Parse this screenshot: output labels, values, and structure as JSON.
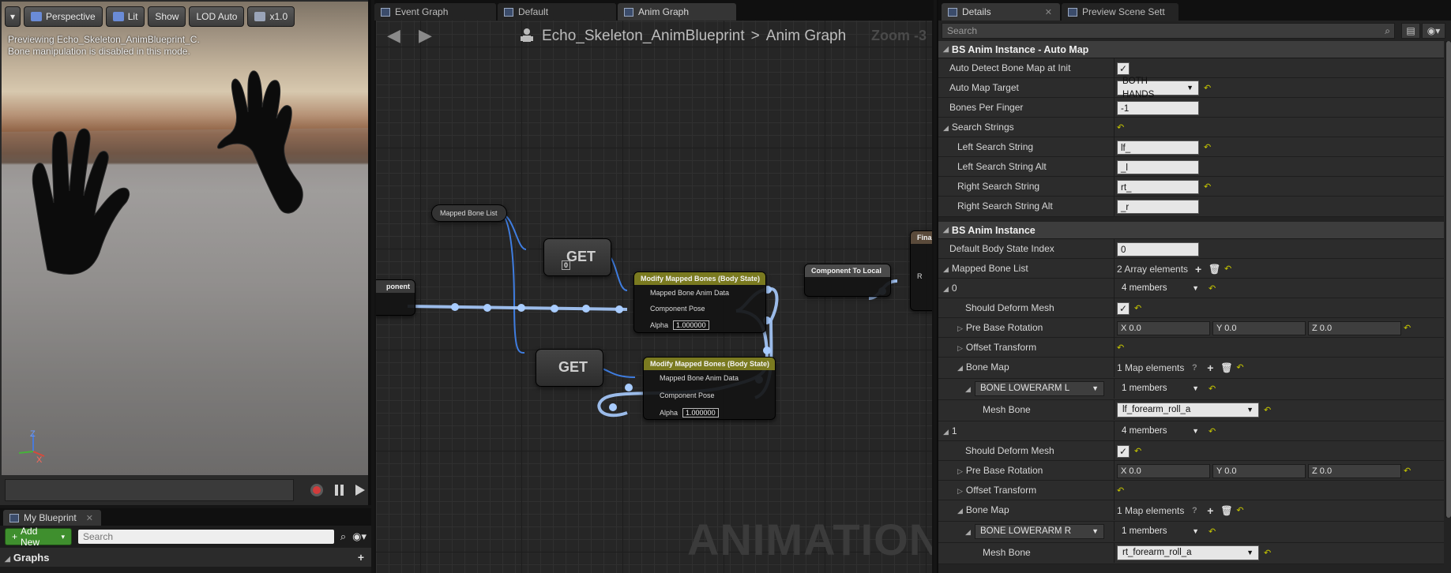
{
  "viewport": {
    "toolbar": {
      "menu_arrow": "▾",
      "perspective": "Perspective",
      "lit": "Lit",
      "show": "Show",
      "lod": "LOD Auto",
      "speed": "x1.0"
    },
    "message_line1": "Previewing Echo_Skeleton_AnimBlueprint_C.",
    "message_line2": "Bone manipulation is disabled in this mode.",
    "axis_x": "X",
    "axis_z": "Z"
  },
  "my_blueprint": {
    "tab": "My Blueprint",
    "add_new": "Add New",
    "search_placeholder": "Search",
    "graphs": "Graphs"
  },
  "graph_editor": {
    "tabs": [
      "Event Graph",
      "Default",
      "Anim Graph"
    ],
    "breadcrumb_root": "Echo_Skeleton_AnimBlueprint",
    "breadcrumb_sep": ">",
    "breadcrumb_leaf": "Anim Graph",
    "zoom": "Zoom -3",
    "watermark": "ANIMATION",
    "nodes": {
      "mapped_bone_list": "Mapped Bone List",
      "get": "GET",
      "get_index": "0",
      "component_left": "ponent",
      "modify_title": "Modify Mapped Bones (Body State)",
      "pin_mapped": "Mapped Bone Anim Data",
      "pin_pose": "Component Pose",
      "pin_alpha": "Alpha",
      "alpha_value": "1.000000",
      "component_to_local": "Component To Local",
      "final": "Final",
      "final_pin": "R"
    }
  },
  "details": {
    "tabs": [
      "Details",
      "Preview Scene Sett"
    ],
    "search_placeholder": "Search",
    "auto_map": {
      "title": "BS Anim Instance - Auto Map",
      "auto_detect_label": "Auto Detect Bone Map at Init",
      "auto_map_target_label": "Auto Map Target",
      "auto_map_target_value": "BOTH HANDS",
      "bones_per_finger_label": "Bones Per Finger",
      "bones_per_finger_value": "-1",
      "search_strings_label": "Search Strings",
      "left_search_label": "Left Search String",
      "left_search_value": "lf_",
      "left_search_alt_label": "Left Search String Alt",
      "left_search_alt_value": "_l",
      "right_search_label": "Right Search String",
      "right_search_value": "rt_",
      "right_search_alt_label": "Right Search String Alt",
      "right_search_alt_value": "_r"
    },
    "instance": {
      "title": "BS Anim Instance",
      "default_body_state_label": "Default Body State Index",
      "default_body_state_value": "0",
      "mapped_bone_list_label": "Mapped Bone List",
      "mapped_bone_list_value": "2 Array elements",
      "entries": [
        {
          "index": "0",
          "members": "4 members",
          "deform_label": "Should Deform Mesh",
          "pre_base_label": "Pre Base Rotation",
          "x": "X  0.0",
          "y": "Y  0.0",
          "z": "Z  0.0",
          "offset_label": "Offset Transform",
          "bone_map_label": "Bone Map",
          "bone_map_value": "1 Map elements",
          "key": "BONE LOWERARM L",
          "key_members": "1 members",
          "mesh_bone_label": "Mesh Bone",
          "mesh_bone_value": "lf_forearm_roll_a"
        },
        {
          "index": "1",
          "members": "4 members",
          "deform_label": "Should Deform Mesh",
          "pre_base_label": "Pre Base Rotation",
          "x": "X  0.0",
          "y": "Y  0.0",
          "z": "Z  0.0",
          "offset_label": "Offset Transform",
          "bone_map_label": "Bone Map",
          "bone_map_value": "1 Map elements",
          "key": "BONE LOWERARM R",
          "key_members": "1 members",
          "mesh_bone_label": "Mesh Bone",
          "mesh_bone_value": "rt_forearm_roll_a"
        }
      ]
    }
  }
}
